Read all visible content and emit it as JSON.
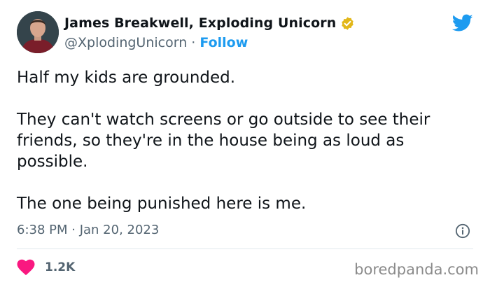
{
  "author": {
    "display_name": "James Breakwell, Exploding Unicorn",
    "handle": "@XplodingUnicorn",
    "separator": "·",
    "follow_label": "Follow",
    "verified_icon": "verified-badge-icon"
  },
  "tweet": {
    "paragraphs": [
      "Half my kids are grounded.",
      "They can't watch screens or go outside to see their friends, so they're in the house being as loud as possible.",
      "The one being punished here is me."
    ],
    "timestamp": "6:38 PM · Jan 20, 2023"
  },
  "engagement": {
    "like_count": "1.2K",
    "like_icon": "heart-icon"
  },
  "watermark": "boredpanda.com",
  "colors": {
    "accent": "#1d9bf0",
    "heart": "#f91880",
    "verified": "#e2b719",
    "muted": "#536471"
  }
}
